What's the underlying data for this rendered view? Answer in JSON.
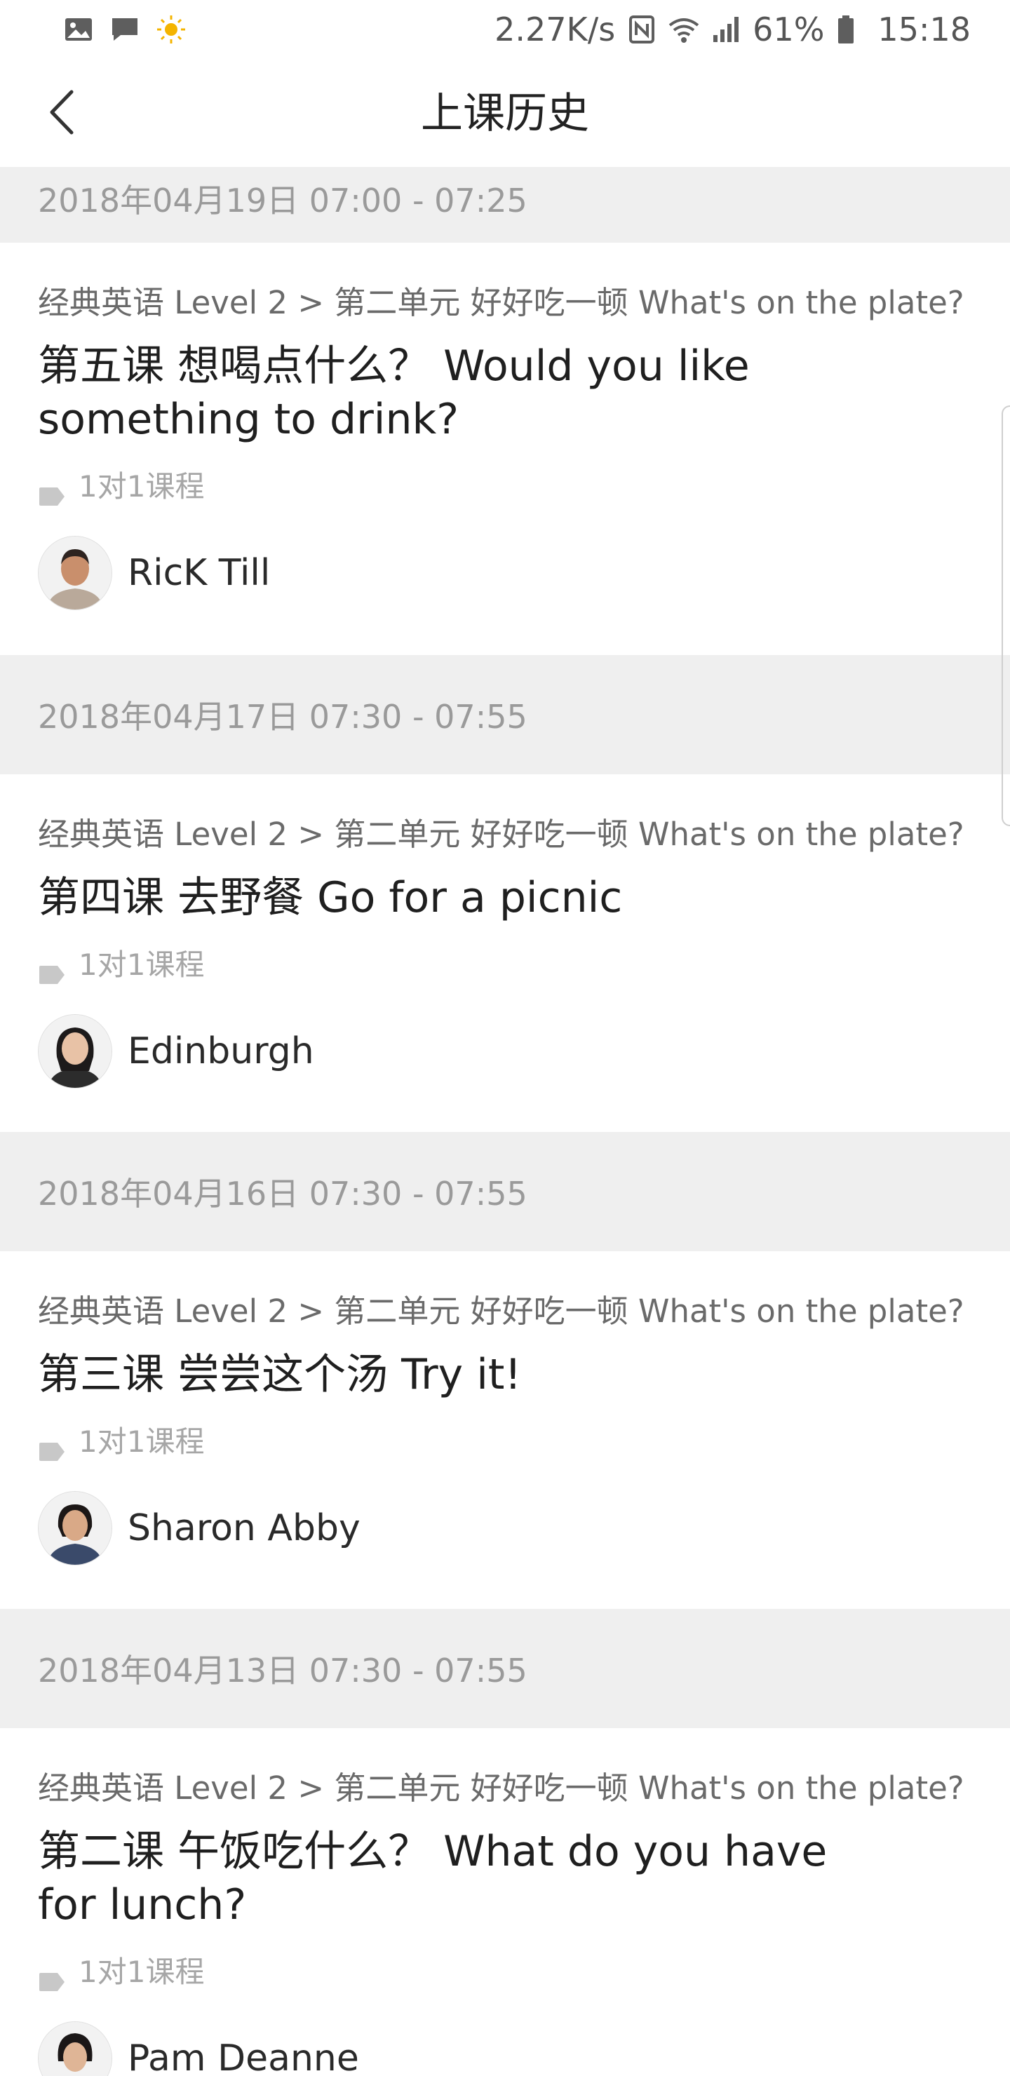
{
  "status_bar": {
    "net_speed": "2.27K/s",
    "battery_pct": "61%",
    "clock": "15:18",
    "left_icons": [
      "gallery-icon",
      "message-icon",
      "sun-icon"
    ],
    "right_icons": [
      "nfc-icon",
      "wifi-icon",
      "signal-icon",
      "battery-icon"
    ]
  },
  "nav": {
    "title": "上课历史",
    "back_icon": "chevron-left-icon"
  },
  "lessons": [
    {
      "date": "2018年04月19日 07:00 - 07:25",
      "course_path": "经典英语 Level 2 > 第二单元 好好吃一顿 What's on the plate?",
      "title": "第五课 想喝点什么？ Would you like something to drink?",
      "course_type": "1对1课程",
      "teacher": "RicK Till"
    },
    {
      "date": "2018年04月17日 07:30 - 07:55",
      "course_path": "经典英语 Level 2 > 第二单元 好好吃一顿 What's on the plate?",
      "title": "第四课 去野餐 Go for a picnic",
      "course_type": "1对1课程",
      "teacher": "Edinburgh"
    },
    {
      "date": "2018年04月16日 07:30 - 07:55",
      "course_path": "经典英语 Level 2 > 第二单元 好好吃一顿 What's on the plate?",
      "title": "第三课 尝尝这个汤 Try it!",
      "course_type": "1对1课程",
      "teacher": "Sharon Abby"
    },
    {
      "date": "2018年04月13日 07:30 - 07:55",
      "course_path": "经典英语 Level 2 > 第二单元 好好吃一顿 What's on the plate?",
      "title": "第二课 午饭吃什么？ What do you have for lunch?",
      "course_type": "1对1课程",
      "teacher": "Pam Deanne"
    }
  ],
  "colors": {
    "date_header_bg": "#efefef",
    "date_text": "#9a9a9a",
    "path_text": "#6a6a6a",
    "title_text": "#1f1f1f",
    "muted_text": "#a6a6a6"
  }
}
